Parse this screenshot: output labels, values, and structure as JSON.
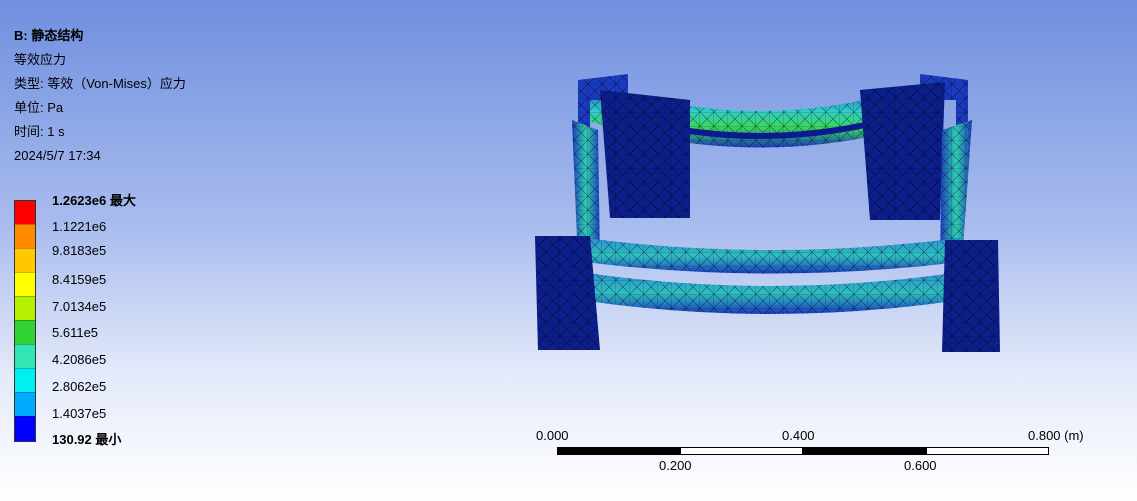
{
  "info": {
    "title": "B: 静态结构",
    "result": "等效应力",
    "type": "类型: 等效（Von-Mises）应力",
    "unit": "单位: Pa",
    "time": "时间: 1 s",
    "date": "2024/5/7 17:34"
  },
  "legend": {
    "labels": [
      "1.2623e6 最大",
      "1.1221e6",
      "9.8183e5",
      "8.4159e5",
      "7.0134e5",
      "5.611e5",
      "4.2086e5",
      "2.8062e5",
      "1.4037e5",
      "130.92 最小"
    ],
    "colors": [
      "#ff0000",
      "#ff8c00",
      "#ffc800",
      "#ffff00",
      "#b4f000",
      "#32d232",
      "#32e6b4",
      "#00f0f0",
      "#00aaff",
      "#0000ff"
    ]
  },
  "scalebar": {
    "top_labels": [
      "0.000",
      "0.400",
      "0.800 (m)"
    ],
    "bottom_labels": [
      "0.200",
      "0.600"
    ]
  },
  "colors": {
    "mesh_dark": "#0d1f8c",
    "mesh_mid": "#1a3bbf",
    "stress_cyan": "#2fd0c8",
    "stress_green": "#3ad65a"
  }
}
